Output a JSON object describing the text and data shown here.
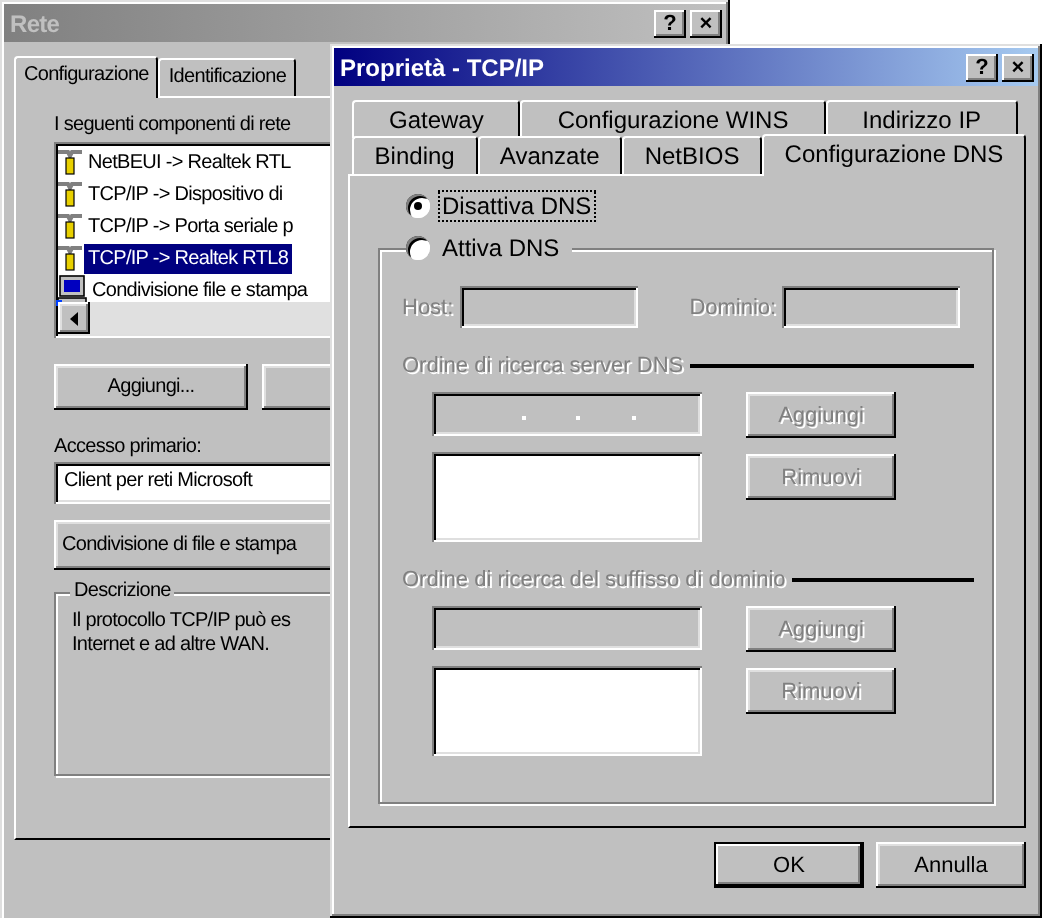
{
  "back_window": {
    "title": "Rete",
    "active": false,
    "title_buttons": [
      "?",
      "×"
    ],
    "tabs": [
      {
        "label": "Configurazione",
        "selected": true
      },
      {
        "label": "Identificazione",
        "selected": false
      }
    ],
    "components_label": "I seguenti componenti di rete",
    "components": [
      {
        "label": "NetBEUI -> Realtek RTL",
        "kind": "protocol",
        "selected": false
      },
      {
        "label": "TCP/IP -> Dispositivo di",
        "kind": "protocol",
        "selected": false
      },
      {
        "label": "TCP/IP -> Porta seriale p",
        "kind": "protocol",
        "selected": false
      },
      {
        "label": "TCP/IP -> Realtek RTL8",
        "kind": "protocol",
        "selected": true
      },
      {
        "label": "Condivisione file e stampa",
        "kind": "service",
        "selected": false
      }
    ],
    "add_button": "Aggiungi...",
    "primary_access": {
      "label": "Accesso primario:",
      "value": "Client per reti Microsoft"
    },
    "sharing_button": "Condivisione di file e stampa",
    "description": {
      "title": "Descrizione",
      "lines": [
        "Il protocollo TCP/IP può es",
        "Internet e ad altre WAN."
      ]
    }
  },
  "front_window": {
    "title": "Proprietà - TCP/IP",
    "active": true,
    "title_buttons": [
      "?",
      "×"
    ],
    "tab_rows": [
      [
        {
          "label": "Gateway",
          "selected": false
        },
        {
          "label": "Configurazione WINS",
          "selected": false
        },
        {
          "label": "Indirizzo IP",
          "selected": false
        }
      ],
      [
        {
          "label": "Binding",
          "selected": false
        },
        {
          "label": "Avanzate",
          "selected": false
        },
        {
          "label": "NetBIOS",
          "selected": false
        },
        {
          "label": "Configurazione DNS",
          "selected": true
        }
      ]
    ],
    "dns_options": [
      {
        "label": "Disattiva DNS",
        "selected": true
      },
      {
        "label": "Attiva DNS",
        "selected": false
      }
    ],
    "dns_settings": {
      "enabled": false,
      "host_label": "Host:",
      "domain_label": "Dominio:",
      "sections": [
        {
          "title": "Ordine di ricerca server DNS",
          "kind": "ip",
          "add_button": "Aggiungi",
          "remove_button": "Rimuovi"
        },
        {
          "title": "Ordine di ricerca del suffisso di dominio",
          "kind": "text",
          "add_button": "Aggiungi",
          "remove_button": "Rimuovi"
        }
      ]
    },
    "buttons": [
      {
        "label": "OK",
        "default": true
      },
      {
        "label": "Annulla",
        "default": false
      }
    ]
  }
}
